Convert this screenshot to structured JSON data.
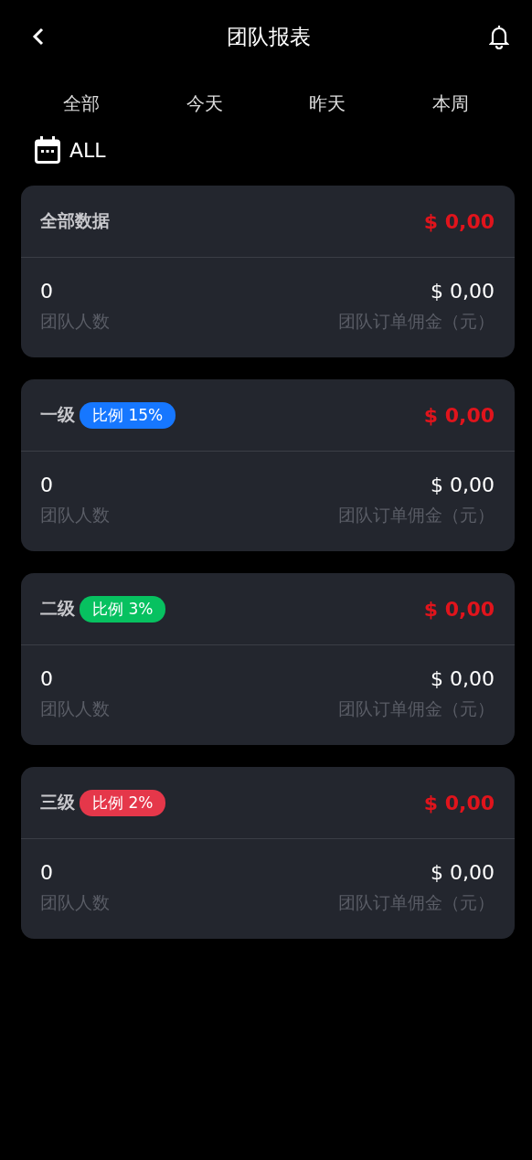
{
  "header": {
    "title": "团队报表"
  },
  "tabs": [
    {
      "label": "全部"
    },
    {
      "label": "今天"
    },
    {
      "label": "昨天"
    },
    {
      "label": "本周"
    }
  ],
  "date_filter": {
    "label": "ALL"
  },
  "cards": [
    {
      "title": "全部数据",
      "total": "$ 0,00",
      "members": "0",
      "members_label": "团队人数",
      "commission": "$ 0,00",
      "commission_label": "团队订单佣金（元）"
    },
    {
      "title": "一级",
      "badge": {
        "label": "比例 15%",
        "color": "#1677ff"
      },
      "total": "$ 0,00",
      "members": "0",
      "members_label": "团队人数",
      "commission": "$ 0,00",
      "commission_label": "团队订单佣金（元）"
    },
    {
      "title": "二级",
      "badge": {
        "label": "比例 3%",
        "color": "#07c160"
      },
      "total": "$ 0,00",
      "members": "0",
      "members_label": "团队人数",
      "commission": "$ 0,00",
      "commission_label": "团队订单佣金（元）"
    },
    {
      "title": "三级",
      "badge": {
        "label": "比例 2%",
        "color": "#e5374a"
      },
      "total": "$ 0,00",
      "members": "0",
      "members_label": "团队人数",
      "commission": "$ 0,00",
      "commission_label": "团队订单佣金（元）"
    }
  ]
}
